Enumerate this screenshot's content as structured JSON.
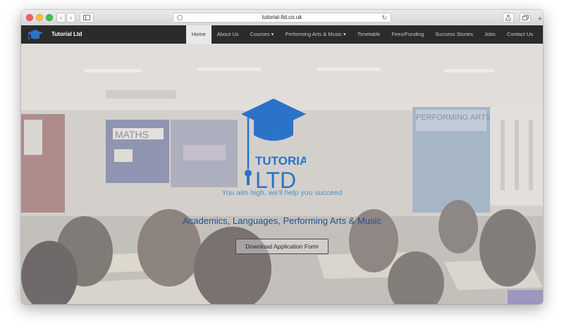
{
  "browser": {
    "url": "tutorial-ltd.co.uk",
    "icons": {
      "back": "chevron-left-icon",
      "forward": "chevron-right-icon",
      "sidebar": "sidebar-icon",
      "reload": "reload-icon",
      "share": "share-icon",
      "tabs": "tabs-icon",
      "new_tab": "plus-icon"
    }
  },
  "nav": {
    "brand": "Tutorial Ltd",
    "items": [
      {
        "label": "Home"
      },
      {
        "label": "About Us"
      },
      {
        "label": "Courses ▾"
      },
      {
        "label": "Performing Arts & Music ▾"
      },
      {
        "label": "Timetable"
      },
      {
        "label": "Fees/Funding"
      },
      {
        "label": "Success Stories"
      },
      {
        "label": "Jobs"
      },
      {
        "label": "Contact Us"
      }
    ]
  },
  "hero": {
    "logo_word": "TUTORIAL",
    "logo_sub": "LTD",
    "tagline": "You aim high, we'll help you succeed",
    "headline": "Academics, Languages, Performing Arts & Music",
    "button": "Download Application Form",
    "wall_sign_1": "MATHS",
    "wall_sign_2": "PERFORMING ARTS"
  },
  "colors": {
    "navbar": "#2b2b2b",
    "accent_blue": "#2a73c8",
    "headline_blue": "#23518c",
    "active_tab": "#e9e9e9"
  }
}
